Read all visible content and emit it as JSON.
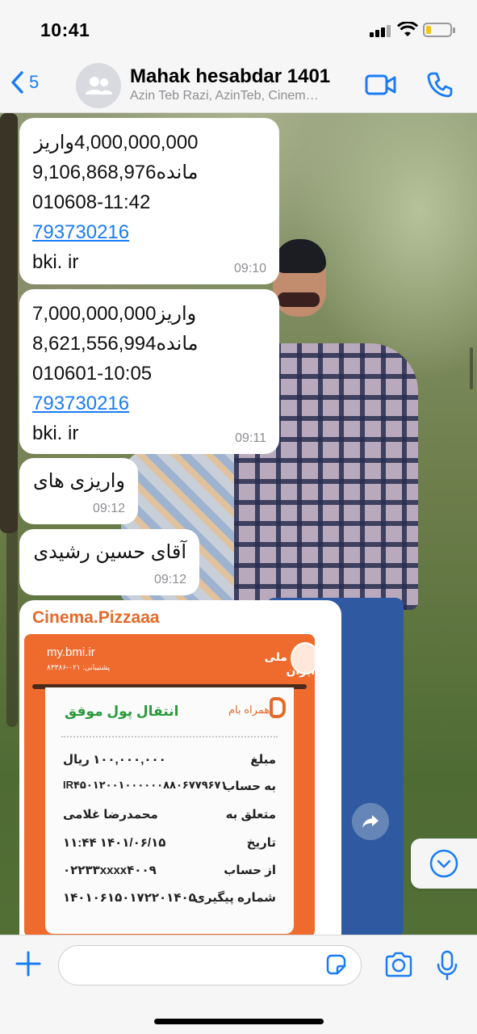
{
  "status_bar": {
    "time": "10:41",
    "battery_level_percent": 20,
    "battery_color": "#f1c40f"
  },
  "header": {
    "back_count": "5",
    "title": "Mahak hesabdar 1401",
    "subtitle": "Azin Teb Razi, AzinTeb, Cinem…",
    "accent_color": "#1a7cf5"
  },
  "messages": [
    {
      "lines": [
        "4,000,000,000واریز",
        "9,106,868,976مانده",
        "010608-11:42"
      ],
      "link": "793730216",
      "footer": "bki. ir",
      "time": "09:10"
    },
    {
      "lines": [
        "7,000,000,000واریز",
        "8,621,556,994مانده",
        "010601-10:05"
      ],
      "link": "793730216",
      "footer": "bki. ir",
      "time": "09:11"
    },
    {
      "text": "واریزی های",
      "time": "09:12"
    },
    {
      "text": "آقای حسین رشیدی",
      "time": "09:12"
    }
  ],
  "image_message": {
    "sender": "Cinema.Pizzaaa",
    "sender_color": "#e36a2a",
    "receipt": {
      "site": "my.bmi.ir",
      "support": "پشتیبانی: ۰۲۱-۸۳۳۸۶",
      "bank_name": "بانک ملی ایران",
      "app_name": "همراه بام",
      "status": "انتقال پول موفق",
      "rows": [
        {
          "label": "مبلغ",
          "value": "۱۰۰,۰۰۰,۰۰۰ ریال"
        },
        {
          "label": "به حساب",
          "value": "IR۴۵۰۱۲۰۰۱۰۰۰۰۰۰۸۸۰۶۷۷۹۶۷۱"
        },
        {
          "label": "متعلق به",
          "value": "محمدرضا غلامی"
        },
        {
          "label": "تاریخ",
          "value": "۱۴۰۱/۰۶/۱۵   ۱۱:۴۴"
        },
        {
          "label": "از حساب",
          "value": "۰۲۲۳۳xxxx۴۰۰۹"
        },
        {
          "label": "شماره پیگیری",
          "value": "۱۴۰۱۰۶۱۵۰۱۷۲۲۰۱۴۰۵"
        }
      ]
    }
  },
  "composer": {
    "placeholder": ""
  }
}
